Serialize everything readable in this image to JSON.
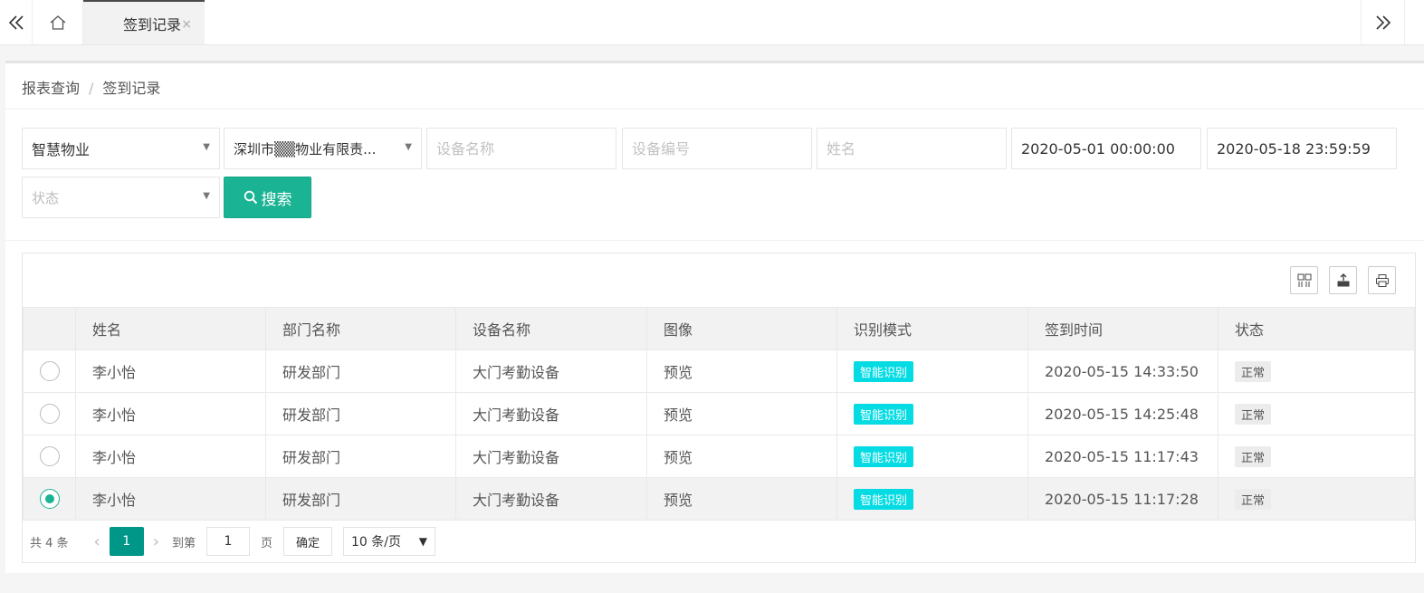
{
  "tabs": {
    "active_label": "签到记录",
    "close_glyph": "×"
  },
  "breadcrumb": {
    "parent": "报表查询",
    "separator": "/",
    "current": "签到记录"
  },
  "filters": {
    "company": "智慧物业",
    "property": "深圳市▒▒物业有限责...",
    "device_name_placeholder": "设备名称",
    "device_code_placeholder": "设备编号",
    "name_placeholder": "姓名",
    "start_time": "2020-05-01 00:00:00",
    "end_time": "2020-05-18 23:59:59",
    "status_placeholder": "状态",
    "search_label": "搜索"
  },
  "table": {
    "columns": [
      "姓名",
      "部门名称",
      "设备名称",
      "图像",
      "识别模式",
      "签到时间",
      "状态"
    ],
    "rows": [
      {
        "name": "李小怡",
        "dept": "研发部门",
        "device": "大门考勤设备",
        "image": "预览",
        "mode": "智能识别",
        "time": "2020-05-15 14:33:50",
        "status": "正常",
        "selected": false
      },
      {
        "name": "李小怡",
        "dept": "研发部门",
        "device": "大门考勤设备",
        "image": "预览",
        "mode": "智能识别",
        "time": "2020-05-15 14:25:48",
        "status": "正常",
        "selected": false
      },
      {
        "name": "李小怡",
        "dept": "研发部门",
        "device": "大门考勤设备",
        "image": "预览",
        "mode": "智能识别",
        "time": "2020-05-15 11:17:43",
        "status": "正常",
        "selected": false
      },
      {
        "name": "李小怡",
        "dept": "研发部门",
        "device": "大门考勤设备",
        "image": "预览",
        "mode": "智能识别",
        "time": "2020-05-15 11:17:28",
        "status": "正常",
        "selected": true
      }
    ]
  },
  "pager": {
    "total": "共 4 条",
    "current_page": "1",
    "goto_label": "到第",
    "goto_value": "1",
    "page_unit": "页",
    "confirm_label": "确定",
    "page_size": "10 条/页"
  },
  "colors": {
    "primary": "#1ab394",
    "pager_active": "#009688",
    "mode_badge": "#04dbe3"
  },
  "icons": {
    "nav_left": "double-chevron-left-icon",
    "home": "home-icon",
    "nav_right": "double-chevron-right-icon",
    "search": "search-icon",
    "columns": "columns-icon",
    "export": "export-icon",
    "print": "print-icon"
  }
}
